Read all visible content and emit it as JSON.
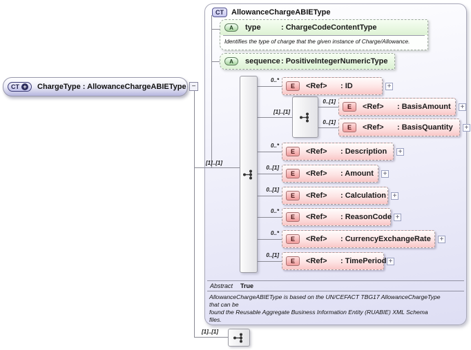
{
  "colors": {
    "panel_fill": "#dedef4",
    "root_fill": "#b6b6de",
    "attribute_green": "#ddf2d4",
    "attribute_badge_green": "#a6d49e",
    "element_pink": "#f9c6c6",
    "element_badge_pink": "#f09c9c",
    "ct_badge_lavender": "#c6c6ee",
    "connector_gray": "#8a8a94"
  },
  "icons": {
    "expand": "+",
    "collapse": "−",
    "derived_plus": "+"
  },
  "root": {
    "badge": "CT",
    "label": "ChargeType : AllowanceChargeABIEType",
    "cardinality": "[1]..[1]"
  },
  "panel": {
    "badge": "CT",
    "title": "AllowanceChargeABIEType",
    "attributes": [
      {
        "badge": "A",
        "name": "type",
        "datatype": ": ChargeCodeContentType",
        "annotation": "Identifies the type of charge that the given instance of Charge/Allowance."
      },
      {
        "badge": "A",
        "name": "sequence",
        "datatype": ": PositiveIntegerNumericType"
      }
    ],
    "sequence_cardinality": "[1]..[1]",
    "group_cardinality": "[1]..[1]",
    "rows": [
      {
        "cardinality": "0..*",
        "badge": "E",
        "ref": "<Ref>",
        "name": ": ID"
      },
      {
        "cardinality": "0..[1]",
        "badge": "E",
        "ref": "<Ref>",
        "name": ": BasisAmount"
      },
      {
        "cardinality": "0..[1]",
        "badge": "E",
        "ref": "<Ref>",
        "name": ": BasisQuantity"
      },
      {
        "cardinality": "0..*",
        "badge": "E",
        "ref": "<Ref>",
        "name": ": Description"
      },
      {
        "cardinality": "0..[1]",
        "badge": "E",
        "ref": "<Ref>",
        "name": ": Amount"
      },
      {
        "cardinality": "0..[1]",
        "badge": "E",
        "ref": "<Ref>",
        "name": ": Calculation"
      },
      {
        "cardinality": "0..*",
        "badge": "E",
        "ref": "<Ref>",
        "name": ": ReasonCode"
      },
      {
        "cardinality": "0..*",
        "badge": "E",
        "ref": "<Ref>",
        "name": ": CurrencyExchangeRate"
      },
      {
        "cardinality": "0..[1]",
        "badge": "E",
        "ref": "<Ref>",
        "name": ": TimePeriod"
      }
    ],
    "abstract": {
      "label": "Abstract",
      "value": "True"
    },
    "annotation": "AllowanceChargeABIEType is based on the UN/CEFACT TBG17 AllowanceChargeType\nthat can be\nfound the Reusable Aggregate Business Information Entity (RUABIE) XML Schema\nfiles."
  }
}
